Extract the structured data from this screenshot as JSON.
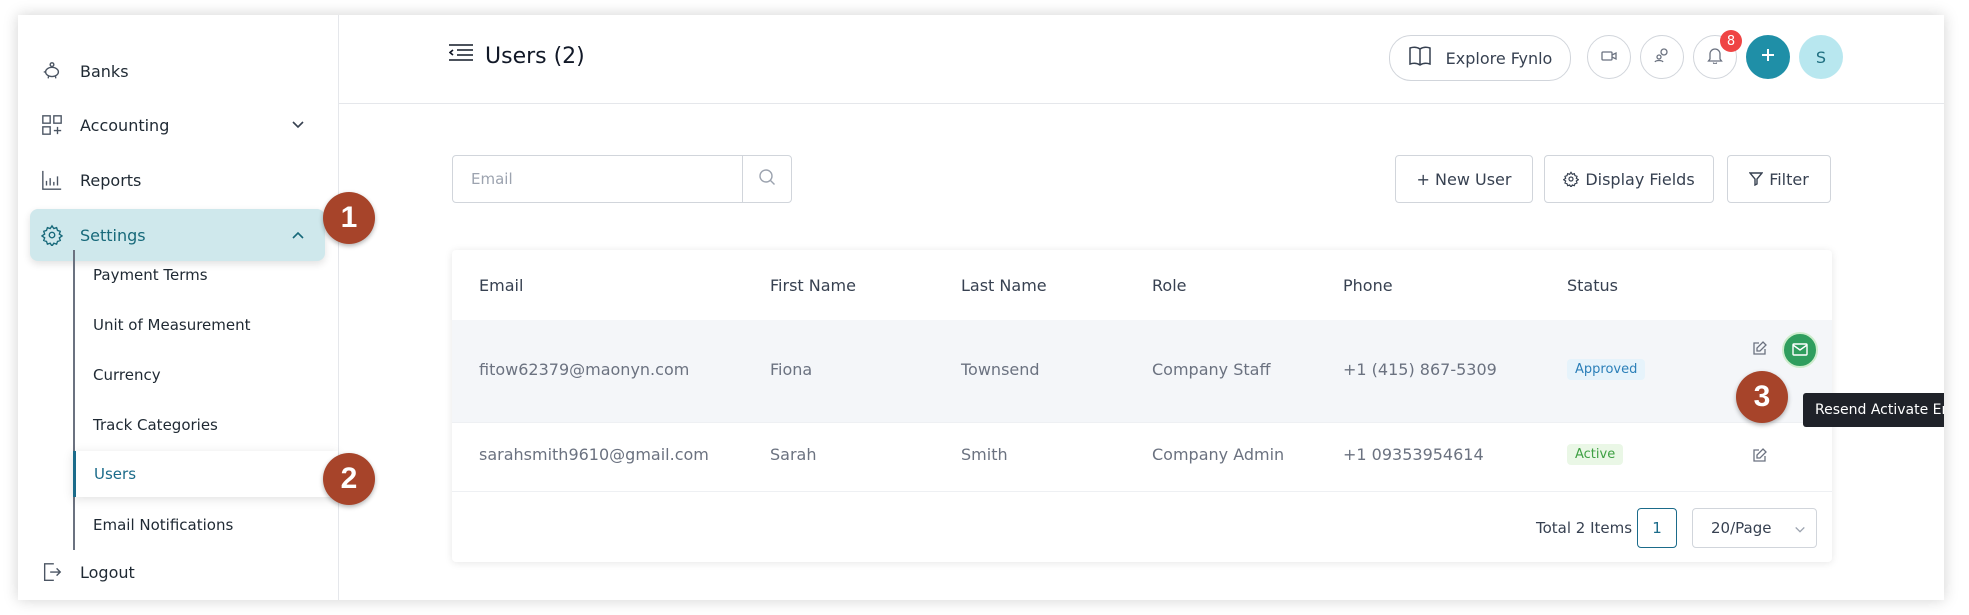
{
  "sidebar": {
    "items": [
      {
        "label": "Banks",
        "icon": "piggy-bank-icon"
      },
      {
        "label": "Accounting",
        "icon": "accounting-icon"
      },
      {
        "label": "Reports",
        "icon": "reports-chart-icon"
      },
      {
        "label": "Settings",
        "icon": "gear-icon"
      },
      {
        "label": "Logout",
        "icon": "logout-icon"
      }
    ],
    "settings_sub": [
      {
        "label": "Payment Terms"
      },
      {
        "label": "Unit of Measurement"
      },
      {
        "label": "Currency"
      },
      {
        "label": "Track Categories"
      },
      {
        "label": "Users"
      },
      {
        "label": "Email Notifications"
      }
    ]
  },
  "markers": [
    "1",
    "2",
    "3"
  ],
  "header": {
    "title": "Users (2)",
    "explore_label": "Explore Fynlo",
    "notification_count": "8",
    "avatar_initial": "S"
  },
  "toolbar": {
    "search_placeholder": "Email",
    "new_user_label": "+ New User",
    "display_fields_label": "Display Fields",
    "filter_label": "Filter"
  },
  "table": {
    "columns": [
      "Email",
      "First Name",
      "Last Name",
      "Role",
      "Phone",
      "Status"
    ],
    "rows": [
      {
        "email": "fitow62379@maonyn.com",
        "first": "Fiona",
        "last": "Townsend",
        "role": "Company Staff",
        "phone": "+1 (415) 867-5309",
        "status": "Approved"
      },
      {
        "email": "sarahsmith9610@gmail.com",
        "first": "Sarah",
        "last": "Smith",
        "role": "Company Admin",
        "phone": "+1 09353954614",
        "status": "Active"
      }
    ],
    "tooltip": "Resend Activate Email"
  },
  "pagination": {
    "total": "Total 2 Items",
    "current_page": "1",
    "per_page": "20/Page"
  },
  "colors": {
    "accent": "#1f8fa7",
    "active_bg": "#cfe8ec",
    "marker": "#a7442a",
    "approved": "#2b7fb8",
    "active_status": "#3ea043",
    "mail_button": "#2f9e5e"
  }
}
